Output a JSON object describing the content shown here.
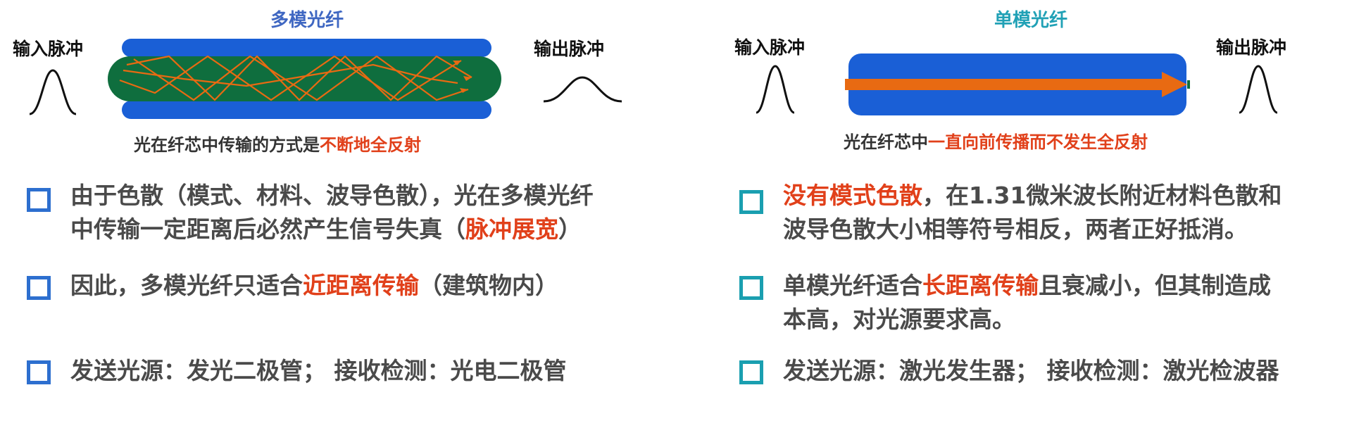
{
  "left": {
    "title": "多模光纤",
    "input_label": "输入脉冲",
    "output_label": "输出脉冲",
    "caption": {
      "prefix": "光在纤芯中传输的方式是",
      "highlight": "不断地全反射"
    },
    "bullets": [
      {
        "line1": "由于色散（模式、材料、波导色散），光在多模光纤",
        "line2_pre": "中传输一定距离后必然产生信号失真（",
        "line2_hl": "脉冲展宽",
        "line2_post": "）"
      },
      {
        "pre": "因此，多模光纤只适合",
        "hl": "近距离传输",
        "post": "（建筑物内）"
      },
      {
        "text": "发送光源：发光二极管；  接收检测：光电二极管"
      }
    ]
  },
  "right": {
    "title": "单模光纤",
    "input_label": "输入脉冲",
    "output_label": "输出脉冲",
    "caption": {
      "prefix": "光在纤芯中",
      "highlight": "一直向前传播而不发生全反射"
    },
    "bullets": [
      {
        "line1_hl": "没有模式色散",
        "line1_post": "，在1.31微米波长附近材料色散和",
        "line2": "波导色散大小相等符号相反，两者正好抵消。"
      },
      {
        "line1_pre": "单模光纤适合",
        "line1_hl": "长距离传输",
        "line1_post": "且衰减小，但其制造成",
        "line2": "本高，对光源要求高。"
      },
      {
        "text": "发送光源：激光发生器；  接收检测：激光检波器"
      }
    ]
  },
  "colors": {
    "cladding": "#1a5fd6",
    "multimode_core": "#0f6e3e",
    "ray": "#e86a12",
    "highlight": "#e1401a"
  }
}
